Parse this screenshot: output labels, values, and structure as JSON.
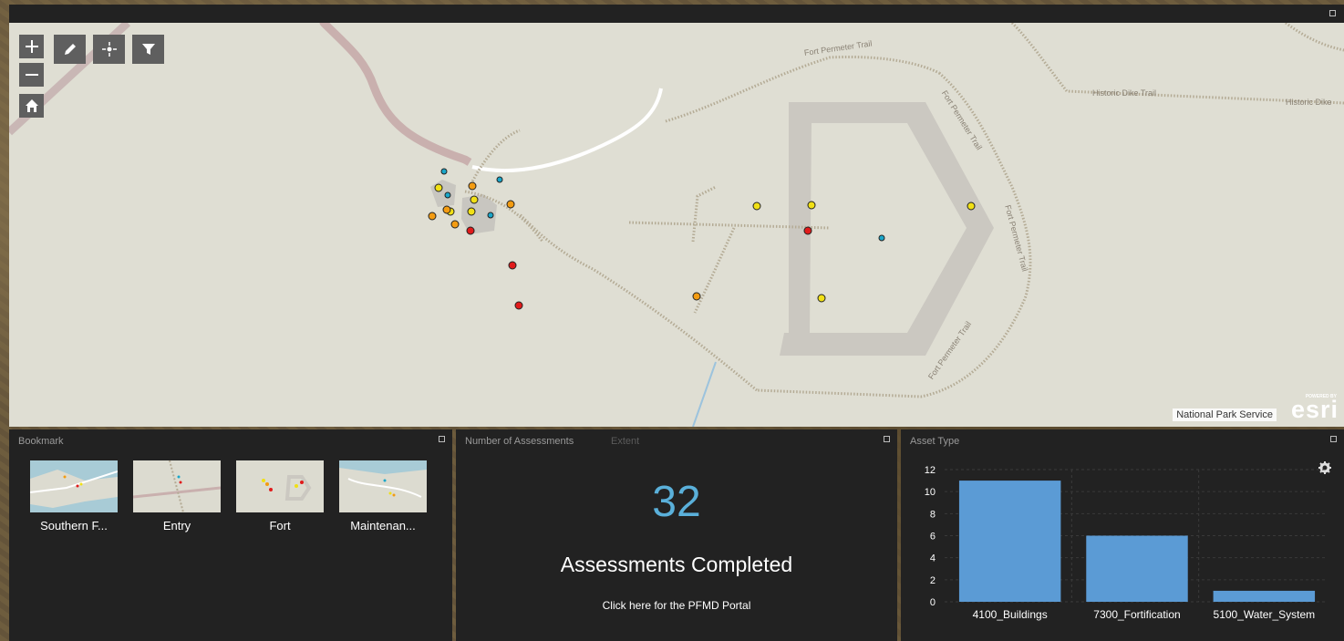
{
  "map": {
    "trail_labels": [
      "Fort Permeter Trail",
      "Fort Permeter Trail",
      "Fort Permeter Trail",
      "Fort Permeter Trail",
      "Historic Dike Trail",
      "Historic Dike"
    ],
    "attribution": "National Park Service",
    "esri_small": "POWERED BY",
    "esri_big": "esri",
    "controls": [
      "zoom-in",
      "zoom-out",
      "home",
      "measure",
      "locate",
      "filter"
    ],
    "point_colors": {
      "red": "#e11b1b",
      "orange": "#f39c12",
      "yellow": "#f1e015",
      "blue": "#1aa6c9"
    }
  },
  "bookmarks": {
    "title": "Bookmark",
    "items": [
      {
        "label": "Southern F..."
      },
      {
        "label": "Entry"
      },
      {
        "label": "Fort"
      },
      {
        "label": "Maintenan..."
      }
    ]
  },
  "assessments": {
    "tab_active": "Number of Assessments",
    "tab_inactive": "Extent",
    "count": "32",
    "caption": "Assessments Completed",
    "link": "Click here for the PFMD Portal",
    "count_color": "#5ab0da"
  },
  "asset_chart": {
    "title": "Asset Type",
    "settings_icon": "gear-icon"
  },
  "chart_data": {
    "type": "bar",
    "categories": [
      "4100_Buildings",
      "7300_Fortification",
      "5100_Water_System"
    ],
    "values": [
      11,
      6,
      1
    ],
    "ylim": [
      0,
      12
    ],
    "yticks": [
      0,
      2,
      4,
      6,
      8,
      10,
      12
    ],
    "bar_color": "#5b9bd5",
    "grid": true
  }
}
